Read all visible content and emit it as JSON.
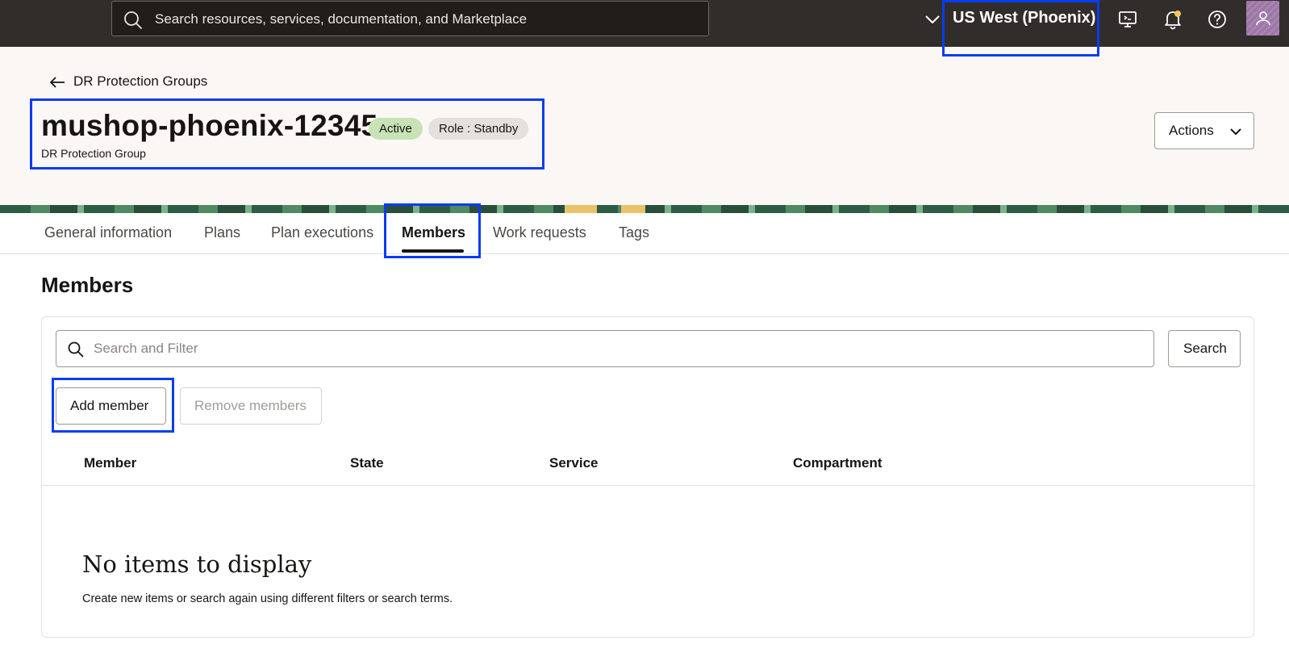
{
  "topbar": {
    "search_placeholder": "Search resources, services, documentation, and Marketplace",
    "region": "US West (Phoenix)"
  },
  "header": {
    "back_label": "DR Protection Groups",
    "title": "mushop-phoenix-12345",
    "status_badge": "Active",
    "role_badge": "Role : Standby",
    "subtitle": "DR Protection Group",
    "actions_label": "Actions"
  },
  "tabs": [
    {
      "label": "General information"
    },
    {
      "label": "Plans"
    },
    {
      "label": "Plan executions"
    },
    {
      "label": "Members"
    },
    {
      "label": "Work requests"
    },
    {
      "label": "Tags"
    }
  ],
  "members": {
    "section_title": "Members",
    "filter_placeholder": "Search and Filter",
    "search_button": "Search",
    "add_button": "Add member",
    "remove_button": "Remove members",
    "columns": [
      "Member",
      "State",
      "Service",
      "Compartment"
    ],
    "empty_title": "No items to display",
    "empty_text": "Create new items or search again using different filters or search terms."
  },
  "colors": {
    "topbar_bg": "#312d2a",
    "header_bg": "#fbf7f4",
    "highlight": "#0a3cf0",
    "active_badge": "#c7e3b6",
    "role_badge": "#e4e1dd",
    "avatar": "#9d77a8"
  },
  "icons": [
    "search-icon",
    "chevron-down-icon",
    "cloud-shell-icon",
    "bell-icon",
    "help-icon",
    "user-icon",
    "back-arrow-icon",
    "filter-search-icon"
  ]
}
